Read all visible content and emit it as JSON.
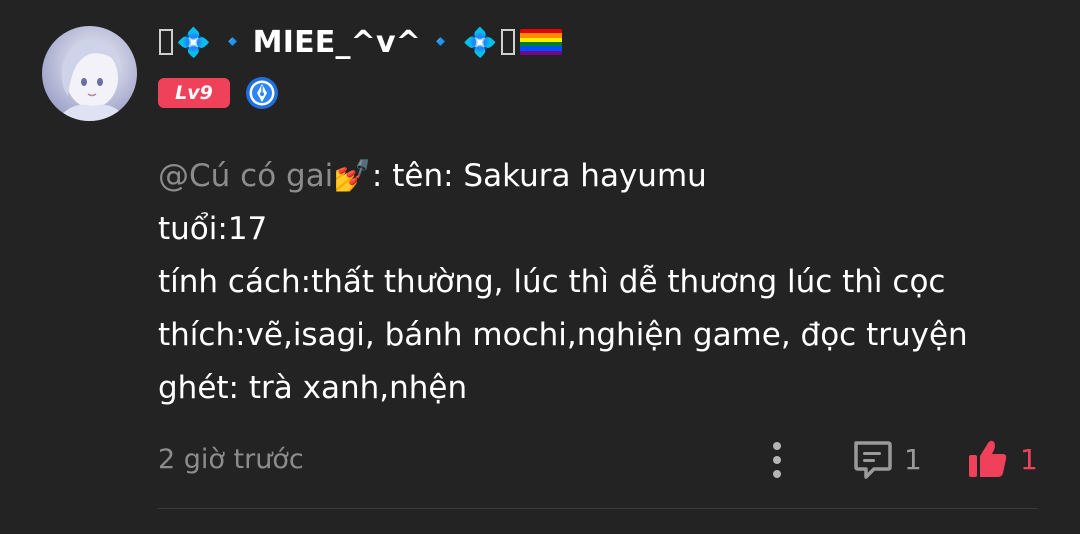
{
  "user": {
    "display_name": "MIEE_^v^",
    "level_badge": "Lv9",
    "avatar_icon": "avatar-anime-girl",
    "verified_icon": "pen-badge-icon",
    "name_decorations": [
      "missing-glyph",
      "diamond-icon",
      "small-blue-diamond",
      "small-blue-diamond",
      "diamond-icon",
      "missing-glyph",
      "rainbow-flag"
    ]
  },
  "comment": {
    "mention": "@Cú có gai",
    "mention_emoji": "💅",
    "first_line_rest": ": tên: Sakura hayumu",
    "lines": [
      "tuổi:17",
      "tính cách:thất thường, lúc thì dễ thương lúc thì cọc",
      "thích:vẽ,isagi, bánh mochi,nghiện game, đọc truyện",
      "ghét: trà xanh,nhện"
    ]
  },
  "meta": {
    "timestamp": "2 giờ trước",
    "reply_count": "1",
    "like_count": "1"
  },
  "colors": {
    "background": "#232323",
    "accent": "#f0415a",
    "muted_text": "#8c8c8c"
  }
}
